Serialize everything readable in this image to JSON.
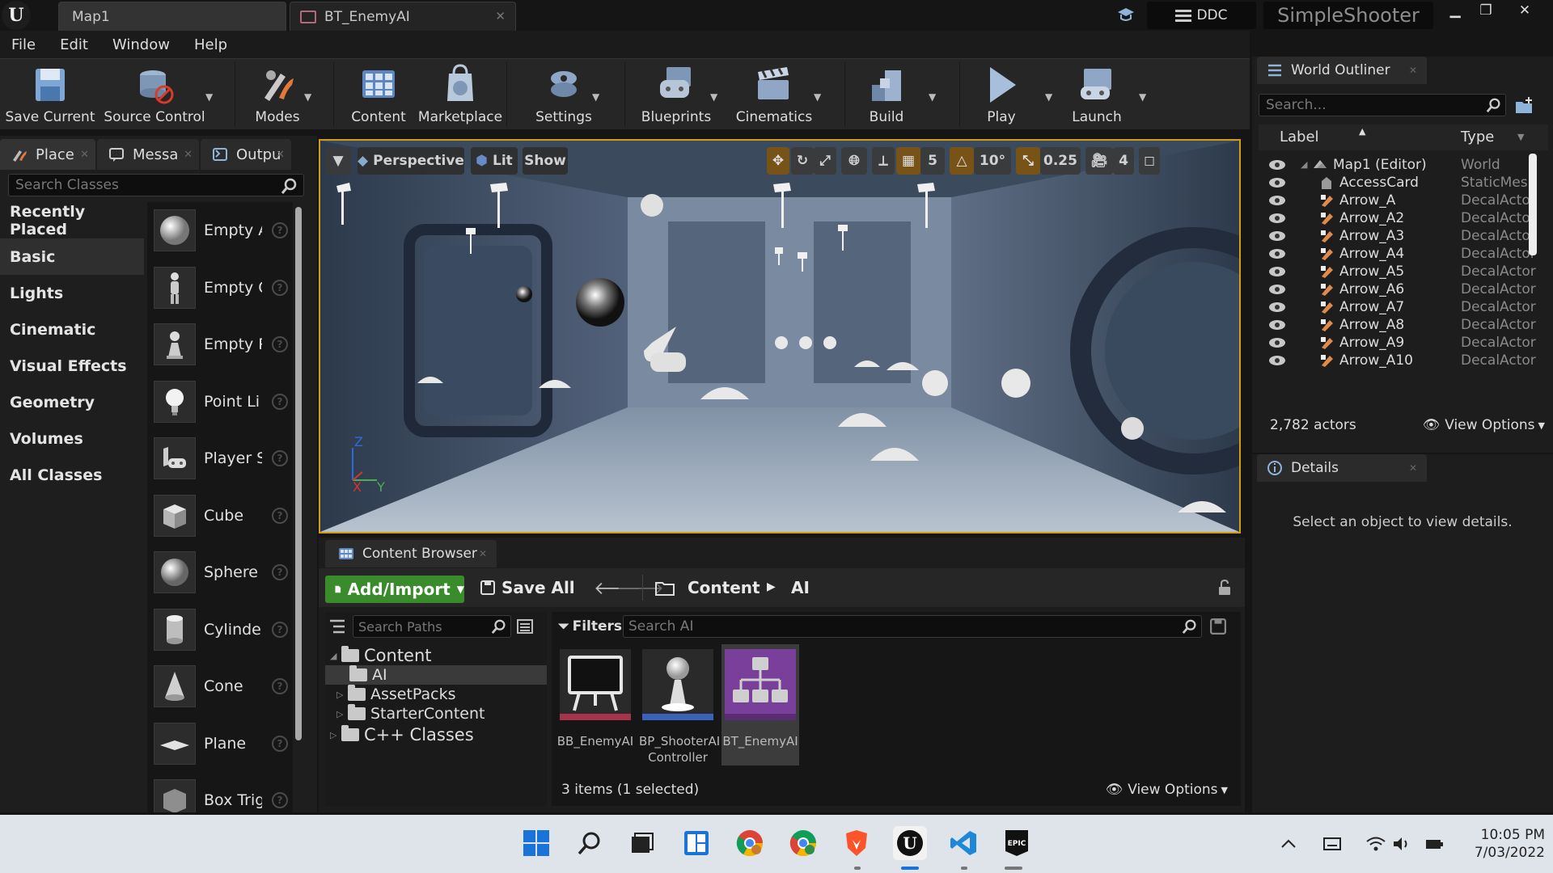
{
  "window": {
    "tabs": [
      {
        "label": "Map1"
      },
      {
        "label": "BT_EnemyAI"
      }
    ],
    "ddc_label": "DDC",
    "project_name": "SimpleShooter"
  },
  "menu": [
    "File",
    "Edit",
    "Window",
    "Help"
  ],
  "toolbar": {
    "items": [
      {
        "label": "Save Current",
        "icon": "save-icon"
      },
      {
        "label": "Source Control",
        "icon": "source-control-icon"
      },
      {
        "label": "Modes",
        "icon": "modes-icon"
      },
      {
        "label": "Content",
        "icon": "content-icon"
      },
      {
        "label": "Marketplace",
        "icon": "marketplace-icon"
      },
      {
        "label": "Settings",
        "icon": "settings-icon"
      },
      {
        "label": "Blueprints",
        "icon": "blueprints-icon"
      },
      {
        "label": "Cinematics",
        "icon": "cinematics-icon"
      },
      {
        "label": "Build",
        "icon": "build-icon"
      },
      {
        "label": "Play",
        "icon": "play-icon"
      },
      {
        "label": "Launch",
        "icon": "launch-icon"
      }
    ]
  },
  "left_panel": {
    "tabs": [
      {
        "label": "Place"
      },
      {
        "label": "Messa"
      },
      {
        "label": "Outpu"
      }
    ],
    "search_placeholder": "Search Classes",
    "categories": [
      "Recently Placed",
      "Basic",
      "Lights",
      "Cinematic",
      "Visual Effects",
      "Geometry",
      "Volumes",
      "All Classes"
    ],
    "active_category": "Basic",
    "assets": [
      {
        "label": "Empty A",
        "icon": "empty-actor-icon"
      },
      {
        "label": "Empty C",
        "icon": "empty-character-icon"
      },
      {
        "label": "Empty P",
        "icon": "empty-pawn-icon"
      },
      {
        "label": "Point Li",
        "icon": "point-light-icon"
      },
      {
        "label": "Player S",
        "icon": "player-start-icon"
      },
      {
        "label": "Cube",
        "icon": "cube-icon"
      },
      {
        "label": "Sphere",
        "icon": "sphere-icon"
      },
      {
        "label": "Cylinder",
        "icon": "cylinder-icon"
      },
      {
        "label": "Cone",
        "icon": "cone-icon"
      },
      {
        "label": "Plane",
        "icon": "plane-icon"
      },
      {
        "label": "Box Trig",
        "icon": "box-trigger-icon"
      }
    ]
  },
  "viewport": {
    "perspective_label": "Perspective",
    "lit_label": "Lit",
    "show_label": "Show",
    "grid_snap": "5",
    "rotation_snap": "10°",
    "scale_snap": "0.25",
    "camera_speed": "4",
    "axis_labels": {
      "z": "Z",
      "x": "X",
      "y": "Y"
    }
  },
  "content_browser": {
    "tab_label": "Content Browser",
    "add_import_label": "Add/Import",
    "save_all_label": "Save All",
    "breadcrumb": [
      "Content",
      "AI"
    ],
    "search_paths_placeholder": "Search Paths",
    "filters_label": "Filters",
    "search_ai_placeholder": "Search AI",
    "tree": [
      {
        "label": "Content",
        "level": 0
      },
      {
        "label": "AI",
        "level": 1
      },
      {
        "label": "AssetPacks",
        "level": 1
      },
      {
        "label": "StarterContent",
        "level": 1
      },
      {
        "label": "C++ Classes",
        "level": 0
      }
    ],
    "assets": [
      {
        "label": "BB_EnemyAI",
        "accent": "#a8334d"
      },
      {
        "label": "BP_ShooterAI Controller",
        "accent": "#3a62b8"
      },
      {
        "label": "BT_EnemyAI",
        "accent": "#7a3f9a"
      }
    ],
    "selected_asset": "BT_EnemyAI",
    "status": "3 items (1 selected)",
    "view_options_label": "View Options"
  },
  "outliner": {
    "tab_label": "World Outliner",
    "search_placeholder": "Search...",
    "col_label": "Label",
    "col_type": "Type",
    "rows": [
      {
        "label": "Map1 (Editor)",
        "type": "World",
        "icon": "world-icon"
      },
      {
        "label": "AccessCard",
        "type": "StaticMesh",
        "icon": "static-mesh-icon"
      },
      {
        "label": "Arrow_A",
        "type": "DecalActor",
        "icon": "decal-icon"
      },
      {
        "label": "Arrow_A2",
        "type": "DecalActor",
        "icon": "decal-icon"
      },
      {
        "label": "Arrow_A3",
        "type": "DecalActor",
        "icon": "decal-icon"
      },
      {
        "label": "Arrow_A4",
        "type": "DecalActor",
        "icon": "decal-icon"
      },
      {
        "label": "Arrow_A5",
        "type": "DecalActor",
        "icon": "decal-icon"
      },
      {
        "label": "Arrow_A6",
        "type": "DecalActor",
        "icon": "decal-icon"
      },
      {
        "label": "Arrow_A7",
        "type": "DecalActor",
        "icon": "decal-icon"
      },
      {
        "label": "Arrow_A8",
        "type": "DecalActor",
        "icon": "decal-icon"
      },
      {
        "label": "Arrow_A9",
        "type": "DecalActor",
        "icon": "decal-icon"
      },
      {
        "label": "Arrow_A10",
        "type": "DecalActor",
        "icon": "decal-icon"
      }
    ],
    "actor_count": "2,782 actors",
    "view_options_label": "View Options"
  },
  "details": {
    "tab_label": "Details",
    "empty_message": "Select an object to view details."
  },
  "taskbar": {
    "apps": [
      "windows-start-icon",
      "search-icon",
      "task-view-icon",
      "widgets-icon",
      "chrome-icon",
      "chrome-alt-icon",
      "brave-icon",
      "unreal-icon",
      "vscode-icon",
      "epic-games-icon"
    ],
    "time": "10:05 PM",
    "date": "7/03/2022"
  },
  "colors": {
    "accent_orange": "#d39b17",
    "add_import_green": "#3a8b2c",
    "editor_bg": "#1d1d1d"
  }
}
